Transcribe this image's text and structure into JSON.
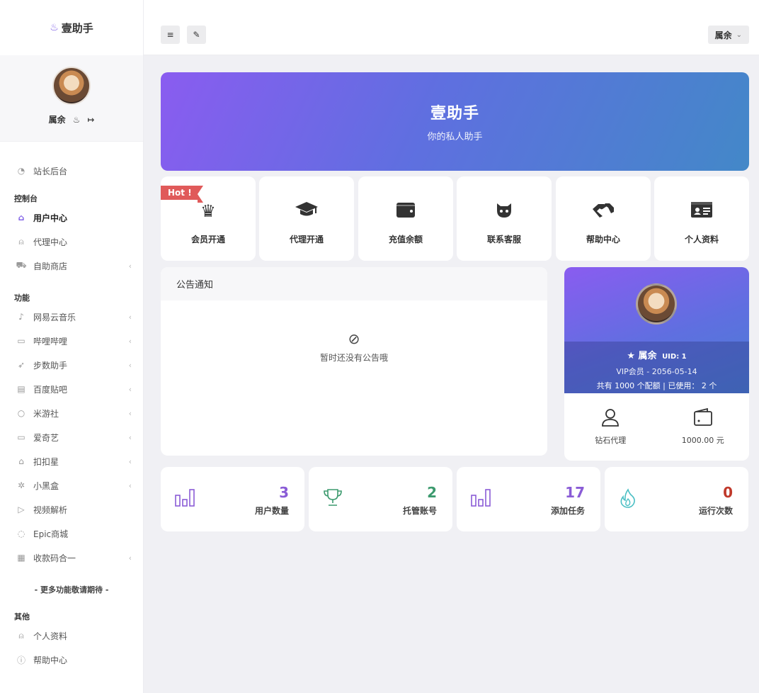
{
  "brand": {
    "name": "壹助手",
    "icon": "flame-icon"
  },
  "user": {
    "name": "属余"
  },
  "sidebar": {
    "top_item": {
      "label": "站长后台",
      "icon": "dashboard-icon"
    },
    "section_control": "控制台",
    "control_items": [
      {
        "label": "用户中心",
        "icon": "home-icon"
      },
      {
        "label": "代理中心",
        "icon": "agent-icon"
      },
      {
        "label": "自助商店",
        "icon": "cart-icon"
      }
    ],
    "section_features": "功能",
    "feature_items": [
      {
        "label": "网易云音乐",
        "icon": "music-icon"
      },
      {
        "label": "哔哩哔哩",
        "icon": "video-icon"
      },
      {
        "label": "步数助手",
        "icon": "rocket-icon"
      },
      {
        "label": "百度贴吧",
        "icon": "book-icon"
      },
      {
        "label": "米游社",
        "icon": "bulb-icon"
      },
      {
        "label": "爱奇艺",
        "icon": "monitor-icon"
      },
      {
        "label": "扣扣星",
        "icon": "graduation-icon"
      },
      {
        "label": "小黑盒",
        "icon": "gear-icon"
      },
      {
        "label": "视频解析",
        "icon": "play-icon"
      },
      {
        "label": "Epic商城",
        "icon": "palette-icon"
      },
      {
        "label": "收款码合一",
        "icon": "qrcode-icon"
      }
    ],
    "more_text": "- 更多功能敬请期待 -",
    "section_other": "其他",
    "other_items": [
      {
        "label": "个人资料",
        "icon": "user-icon"
      },
      {
        "label": "帮助中心",
        "icon": "info-icon"
      }
    ]
  },
  "hero": {
    "title": "壹助手",
    "subtitle": "你的私人助手"
  },
  "quick": [
    {
      "label": "会员开通",
      "icon": "crown-icon",
      "badge": "Hot !"
    },
    {
      "label": "代理开通",
      "icon": "graduation-cap-icon"
    },
    {
      "label": "充值余额",
      "icon": "wallet-icon"
    },
    {
      "label": "联系客服",
      "icon": "github-icon"
    },
    {
      "label": "帮助中心",
      "icon": "handshake-icon"
    },
    {
      "label": "个人资料",
      "icon": "id-card-icon"
    }
  ],
  "notice": {
    "title": "公告通知",
    "empty_text": "暂时还没有公告哦",
    "empty_icon": "ban-disc-icon"
  },
  "profile": {
    "name": "属余",
    "uid": "UID: 1",
    "vip": "VIP会员 - 2056-05-14",
    "quota": "共有 1000 个配额 | 已使用： 2 个",
    "level": "钻石代理",
    "balance": "1000.00 元"
  },
  "stats": [
    {
      "value": "3",
      "label": "用户数量",
      "icon": "bar-chart-icon",
      "color": "#8a5cd6"
    },
    {
      "value": "2",
      "label": "托管账号",
      "icon": "trophy-icon",
      "color": "#3c9a6e"
    },
    {
      "value": "17",
      "label": "添加任务",
      "icon": "bar-chart-icon",
      "color": "#8a5cd6"
    },
    {
      "value": "0",
      "label": "运行次数",
      "icon": "fire-icon",
      "color": "#c0392b"
    }
  ]
}
